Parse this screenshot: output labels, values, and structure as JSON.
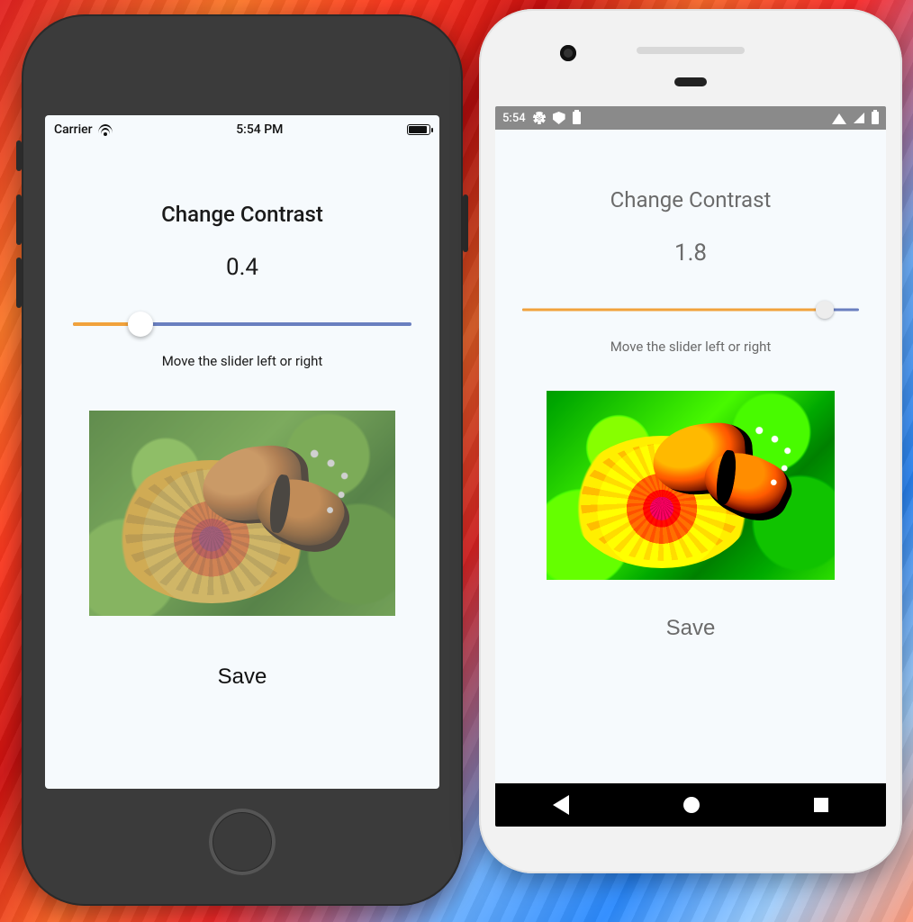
{
  "ios": {
    "status": {
      "carrier": "Carrier",
      "time": "5:54 PM"
    },
    "title": "Change Contrast",
    "value": "0.4",
    "slider": {
      "min": 0,
      "max": 2,
      "value": 0.4,
      "percent": 20
    },
    "hint": "Move the slider left or right",
    "save_label": "Save",
    "colors": {
      "track_fill": "#f1a23c",
      "track_bg": "#6a7fc0"
    }
  },
  "android": {
    "status": {
      "time": "5:54"
    },
    "title": "Change Contrast",
    "value": "1.8",
    "slider": {
      "min": 0,
      "max": 2,
      "value": 1.8,
      "percent": 90
    },
    "hint": "Move the slider left or right",
    "save_label": "Save",
    "nav": {
      "back": "back",
      "home": "home",
      "recent": "recent"
    },
    "colors": {
      "track_fill": "#f1a23c",
      "track_bg": "#6a7fc0"
    }
  }
}
